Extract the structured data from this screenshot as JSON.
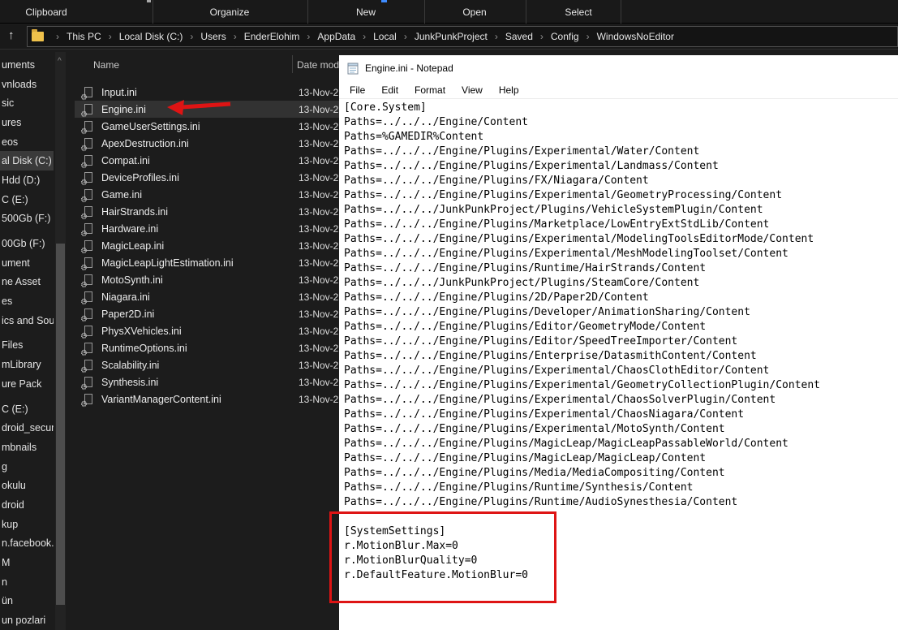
{
  "explorer": {
    "ribbon": {
      "groups": [
        "Clipboard",
        "Organize",
        "New",
        "Open",
        "Select"
      ]
    },
    "breadcrumb": {
      "items": [
        "This PC",
        "Local Disk (C:)",
        "Users",
        "EnderElohim",
        "AppData",
        "Local",
        "JunkPunkProject",
        "Saved",
        "Config",
        "WindowsNoEditor"
      ],
      "separator": "›",
      "up_arrow": "↑"
    },
    "sidebar": {
      "items": [
        {
          "label": "uments"
        },
        {
          "label": "vnloads"
        },
        {
          "label": "sic"
        },
        {
          "label": "ures"
        },
        {
          "label": "eos"
        },
        {
          "label": "al Disk (C:)",
          "selected": true
        },
        {
          "label": "Hdd (D:)"
        },
        {
          "label": "C (E:)"
        },
        {
          "label": "500Gb (F:)"
        },
        {
          "label": "00Gb (F:)",
          "gap": true
        },
        {
          "label": "ument"
        },
        {
          "label": "ne Asset"
        },
        {
          "label": "es"
        },
        {
          "label": "ics and Sour"
        },
        {
          "label": "Files",
          "gap": true
        },
        {
          "label": "mLibrary"
        },
        {
          "label": "ure Pack"
        },
        {
          "label": "C (E:)",
          "gap": true
        },
        {
          "label": "droid_secure"
        },
        {
          "label": "mbnails"
        },
        {
          "label": "g"
        },
        {
          "label": "okulu"
        },
        {
          "label": "droid"
        },
        {
          "label": "kup"
        },
        {
          "label": "n.facebook.or"
        },
        {
          "label": "M"
        },
        {
          "label": "n"
        },
        {
          "label": "ün"
        },
        {
          "label": "un pozlari"
        }
      ],
      "scroll_up_glyph": "^"
    },
    "file_list": {
      "columns": [
        "Name",
        "Date mod"
      ],
      "file_icon_glyph": "⚙",
      "rows": [
        {
          "name": "Input.ini",
          "date": "13-Nov-2"
        },
        {
          "name": "Engine.ini",
          "date": "13-Nov-2",
          "selected": true
        },
        {
          "name": "GameUserSettings.ini",
          "date": "13-Nov-2"
        },
        {
          "name": "ApexDestruction.ini",
          "date": "13-Nov-2"
        },
        {
          "name": "Compat.ini",
          "date": "13-Nov-2"
        },
        {
          "name": "DeviceProfiles.ini",
          "date": "13-Nov-2"
        },
        {
          "name": "Game.ini",
          "date": "13-Nov-2"
        },
        {
          "name": "HairStrands.ini",
          "date": "13-Nov-2"
        },
        {
          "name": "Hardware.ini",
          "date": "13-Nov-2"
        },
        {
          "name": "MagicLeap.ini",
          "date": "13-Nov-2"
        },
        {
          "name": "MagicLeapLightEstimation.ini",
          "date": "13-Nov-2"
        },
        {
          "name": "MotoSynth.ini",
          "date": "13-Nov-2"
        },
        {
          "name": "Niagara.ini",
          "date": "13-Nov-2"
        },
        {
          "name": "Paper2D.ini",
          "date": "13-Nov-2"
        },
        {
          "name": "PhysXVehicles.ini",
          "date": "13-Nov-2"
        },
        {
          "name": "RuntimeOptions.ini",
          "date": "13-Nov-2"
        },
        {
          "name": "Scalability.ini",
          "date": "13-Nov-2"
        },
        {
          "name": "Synthesis.ini",
          "date": "13-Nov-2"
        },
        {
          "name": "VariantManagerContent.ini",
          "date": "13-Nov-2"
        }
      ]
    }
  },
  "notepad": {
    "title": "Engine.ini - Notepad",
    "menus": [
      "File",
      "Edit",
      "Format",
      "View",
      "Help"
    ],
    "content_lines": [
      "[Core.System]",
      "Paths=../../../Engine/Content",
      "Paths=%GAMEDIR%Content",
      "Paths=../../../Engine/Plugins/Experimental/Water/Content",
      "Paths=../../../Engine/Plugins/Experimental/Landmass/Content",
      "Paths=../../../Engine/Plugins/FX/Niagara/Content",
      "Paths=../../../Engine/Plugins/Experimental/GeometryProcessing/Content",
      "Paths=../../../JunkPunkProject/Plugins/VehicleSystemPlugin/Content",
      "Paths=../../../Engine/Plugins/Marketplace/LowEntryExtStdLib/Content",
      "Paths=../../../Engine/Plugins/Experimental/ModelingToolsEditorMode/Content",
      "Paths=../../../Engine/Plugins/Experimental/MeshModelingToolset/Content",
      "Paths=../../../Engine/Plugins/Runtime/HairStrands/Content",
      "Paths=../../../JunkPunkProject/Plugins/SteamCore/Content",
      "Paths=../../../Engine/Plugins/2D/Paper2D/Content",
      "Paths=../../../Engine/Plugins/Developer/AnimationSharing/Content",
      "Paths=../../../Engine/Plugins/Editor/GeometryMode/Content",
      "Paths=../../../Engine/Plugins/Editor/SpeedTreeImporter/Content",
      "Paths=../../../Engine/Plugins/Enterprise/DatasmithContent/Content",
      "Paths=../../../Engine/Plugins/Experimental/ChaosClothEditor/Content",
      "Paths=../../../Engine/Plugins/Experimental/GeometryCollectionPlugin/Content",
      "Paths=../../../Engine/Plugins/Experimental/ChaosSolverPlugin/Content",
      "Paths=../../../Engine/Plugins/Experimental/ChaosNiagara/Content",
      "Paths=../../../Engine/Plugins/Experimental/MotoSynth/Content",
      "Paths=../../../Engine/Plugins/MagicLeap/MagicLeapPassableWorld/Content",
      "Paths=../../../Engine/Plugins/MagicLeap/MagicLeap/Content",
      "Paths=../../../Engine/Plugins/Media/MediaCompositing/Content",
      "Paths=../../../Engine/Plugins/Runtime/Synthesis/Content",
      "Paths=../../../Engine/Plugins/Runtime/AudioSynesthesia/Content",
      "",
      "[SystemSettings]",
      "r.MotionBlur.Max=0",
      "r.MotionBlurQuality=0",
      "r.DefaultFeature.MotionBlur=0"
    ]
  },
  "annotations": {
    "arrow_color": "#de1414",
    "box_color": "#de1414"
  },
  "colors": {
    "explorer_background": "#1c1c1c",
    "selection_gray": "#323232",
    "folder_yellow": "#f0c24b",
    "notepad_background": "#ffffff"
  }
}
